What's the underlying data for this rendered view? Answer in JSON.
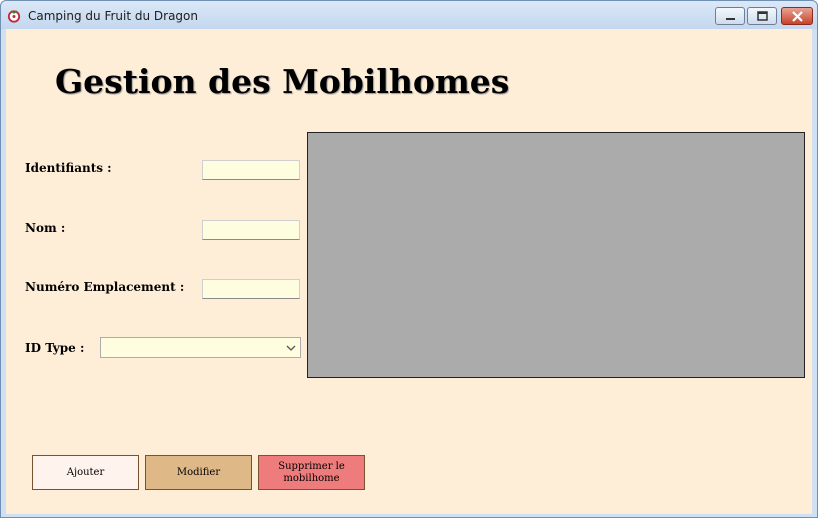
{
  "window": {
    "title": "Camping du Fruit du Dragon"
  },
  "page": {
    "heading": "Gestion des Mobilhomes"
  },
  "form": {
    "identifiants_label": "Identifiants :",
    "identifiants_value": "",
    "nom_label": "Nom :",
    "nom_value": "",
    "emplacement_label": "Numéro Emplacement :",
    "emplacement_value": "",
    "idtype_label": "ID Type :",
    "idtype_value": ""
  },
  "buttons": {
    "add": "Ajouter",
    "edit": "Modifier",
    "delete": "Supprimer le mobilhome"
  },
  "colors": {
    "background": "#ffeed7",
    "input_background": "#fffde0",
    "grid_background": "#ababab",
    "add_button": "#fff3ee",
    "edit_button": "#dfb887",
    "delete_button": "#ef7c7c"
  },
  "icons": {
    "app": "dragon-fruit-icon",
    "minimize": "minimize-icon",
    "maximize": "maximize-icon",
    "close": "close-icon",
    "dropdown": "chevron-down-icon"
  }
}
